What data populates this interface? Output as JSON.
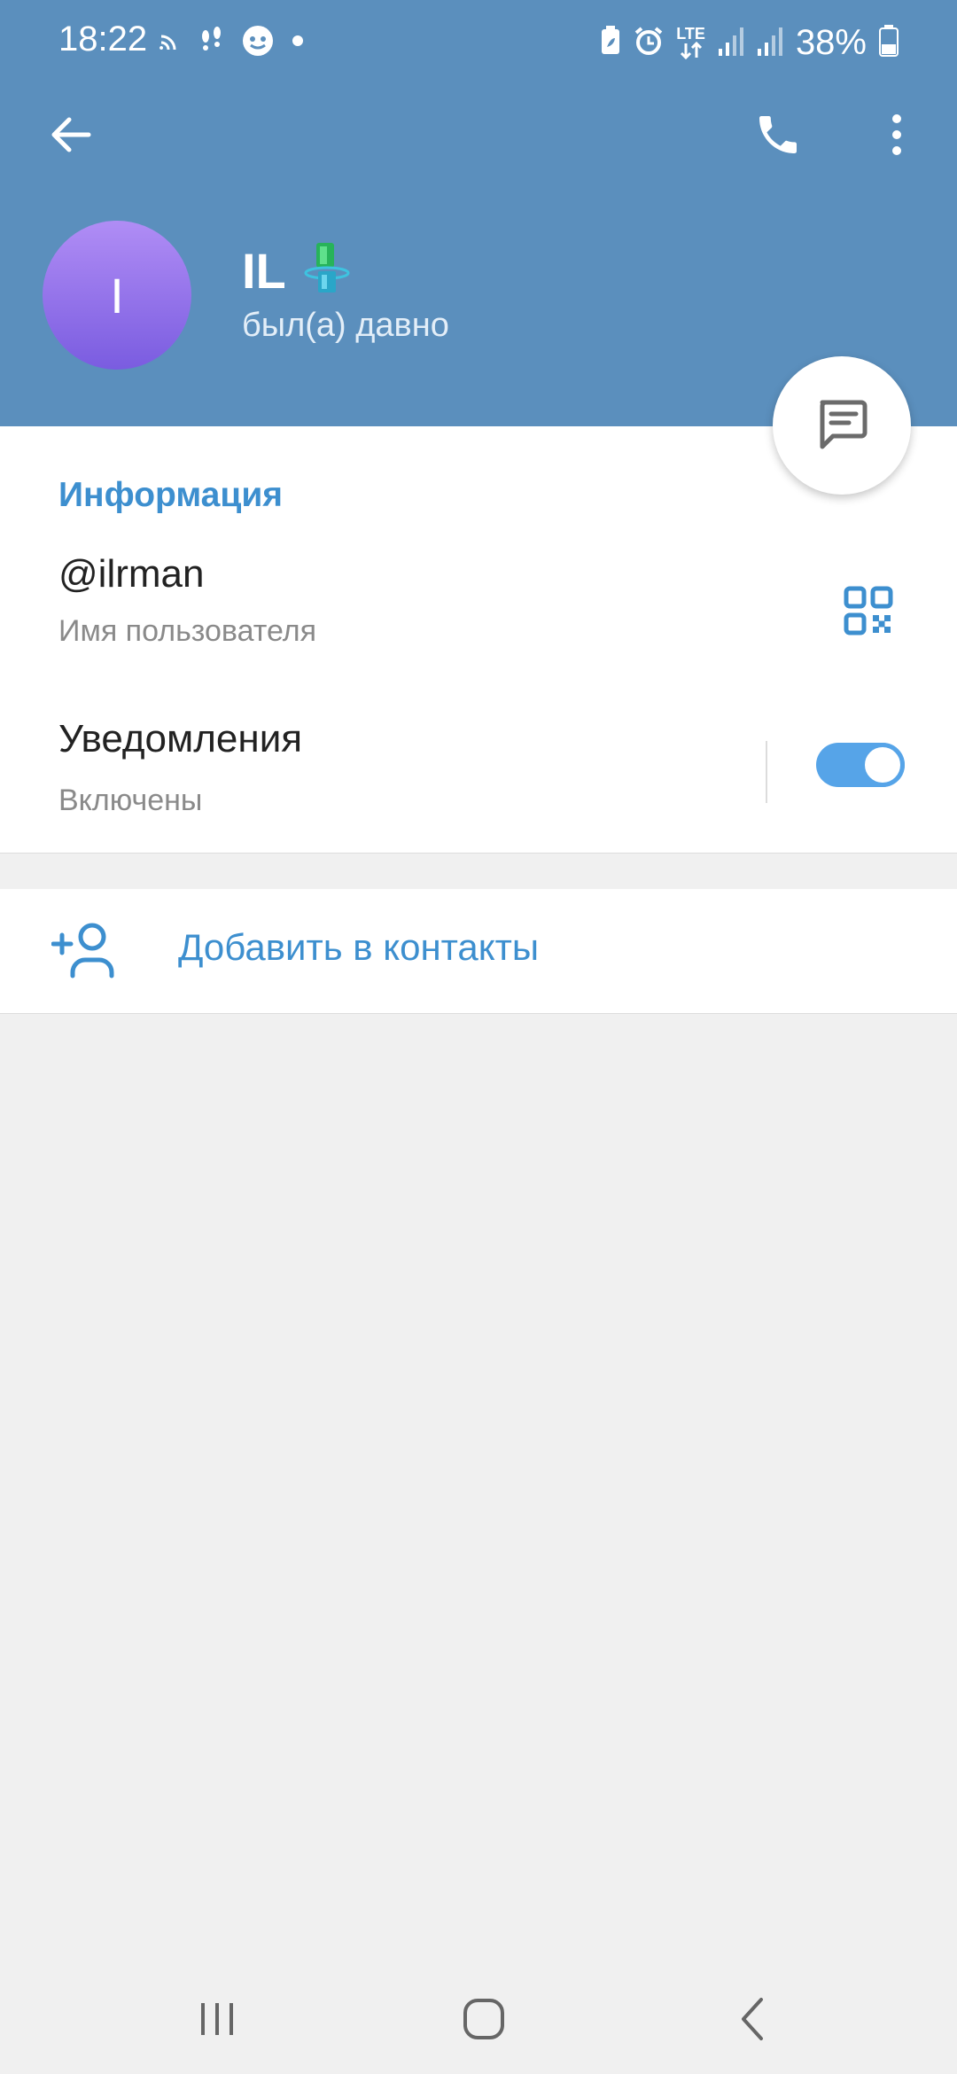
{
  "status_bar": {
    "time": "18:22",
    "battery_percent": "38%",
    "network_label": "LTE",
    "left_icons": [
      "cast-icon",
      "footsteps-icon",
      "chat-bubble-icon",
      "dot-icon"
    ],
    "right_icons": [
      "battery-saver-icon",
      "alarm-icon",
      "lte-data-icon",
      "signal-icon",
      "signal-icon",
      "battery-icon"
    ]
  },
  "header": {
    "back_icon": "arrow-left-icon",
    "call_icon": "phone-icon",
    "more_icon": "more-vertical-icon",
    "background_color": "#5b8fbd"
  },
  "profile": {
    "avatar_letter": "I",
    "name": "IL",
    "status": "был(а) давно",
    "badge_icon": "premium-emoji-icon"
  },
  "fab": {
    "icon": "message-icon"
  },
  "info": {
    "section_title": "Информация",
    "username": "@ilrman",
    "username_caption": "Имя пользователя",
    "qr_icon": "qr-code-icon",
    "notifications_title": "Уведомления",
    "notifications_status": "Включены",
    "notifications_enabled": true
  },
  "actions": {
    "add_contact_label": "Добавить в контакты",
    "add_contact_icon": "add-user-icon"
  },
  "navigation_bar": {
    "icons": [
      "recent-apps-icon",
      "home-icon",
      "back-icon"
    ]
  },
  "colors": {
    "accent": "#3d8fcf",
    "toggle_on": "#56a4e8",
    "avatar_top": "#b08df5",
    "avatar_bottom": "#7a5ce0"
  }
}
